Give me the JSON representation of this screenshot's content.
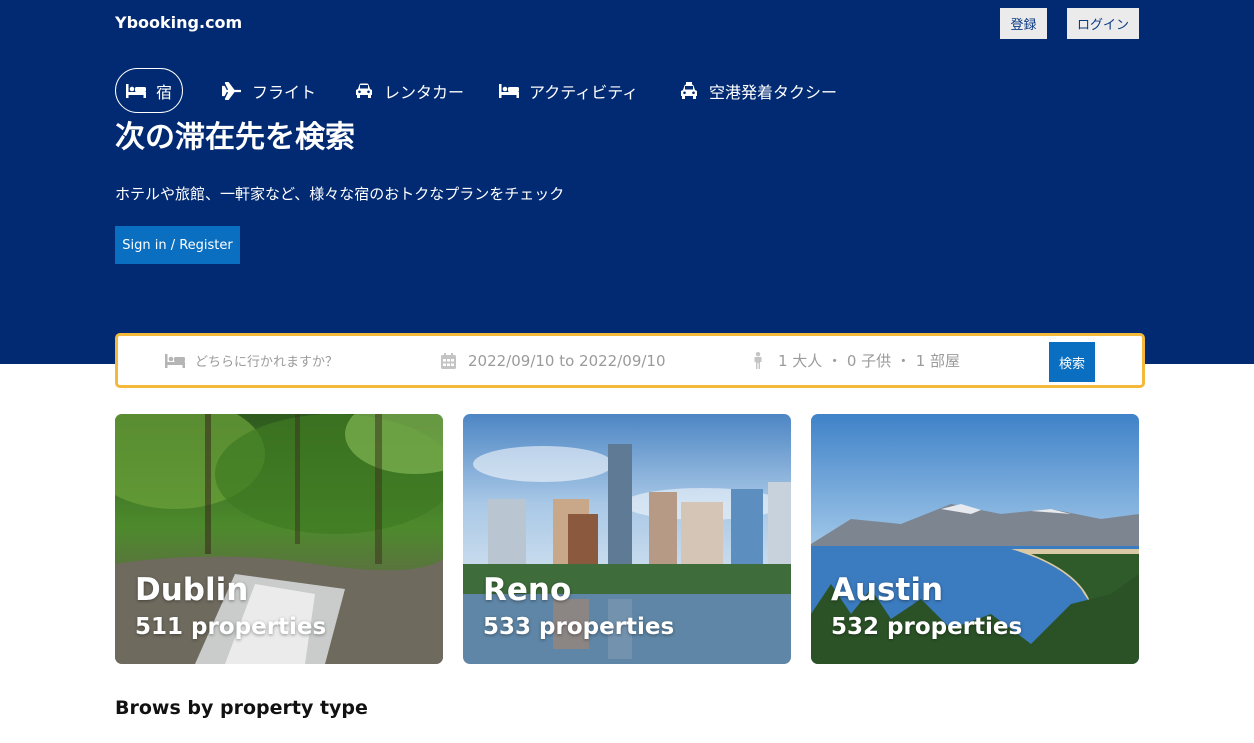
{
  "header": {
    "logo": "Ybooking.com",
    "register_label": "登録",
    "login_label": "ログイン"
  },
  "tabs": [
    {
      "label": "宿",
      "icon": "bed-icon",
      "active": true
    },
    {
      "label": "フライト",
      "icon": "plane-icon",
      "active": false
    },
    {
      "label": "レンタカー",
      "icon": "car-icon",
      "active": false
    },
    {
      "label": "アクティビティ",
      "icon": "bed-icon",
      "active": false
    },
    {
      "label": "空港発着タクシー",
      "icon": "taxi-icon",
      "active": false
    }
  ],
  "hero": {
    "headline": "次の滞在先を検索",
    "subline": "ホテルや旅館、一軒家など、様々な宿のおトクなプランをチェック",
    "signin_label": "Sign in / Register"
  },
  "search": {
    "destination_placeholder": "どちらに行かれますか？",
    "dates": "2022/09/10 to 2022/09/10",
    "guests": "1 大人 ・ 0 子供 ・ 1 部屋",
    "button_label": "検索"
  },
  "destinations": [
    {
      "city": "Dublin",
      "properties": "511 properties"
    },
    {
      "city": "Reno",
      "properties": "533 properties"
    },
    {
      "city": "Austin",
      "properties": "532 properties"
    }
  ],
  "sections": {
    "property_type_title": "Brows by property type"
  },
  "colors": {
    "hero_bg": "#022a72",
    "primary_button": "#0a6ec1",
    "search_border": "#f4b93a"
  }
}
